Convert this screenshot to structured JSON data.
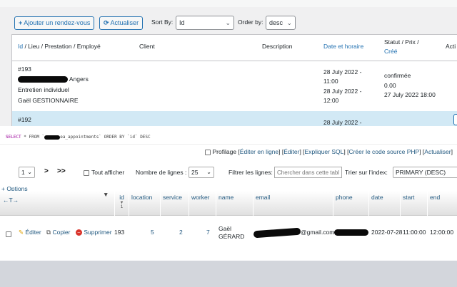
{
  "wp": {
    "toolbar": {
      "add_label": "Ajouter un rendez-vous",
      "refresh_label": "Actualiser",
      "sort_by_label": "Sort By:",
      "sort_by_value": "Id",
      "order_by_label": "Order by:",
      "order_by_value": "desc"
    },
    "columns": {
      "id_group": "Id / Lieu / Prestation / Employé",
      "client": "Client",
      "description": "Description",
      "datetime": "Date et horaire",
      "status_line1": "Statut / Prix /",
      "status_line2": "Créé",
      "actions": "Acti"
    },
    "row1": {
      "id": "#193",
      "location": "Angers",
      "service": "Entretien individuel",
      "employee": "Gaël GESTIONNAIRE",
      "date_start": "28 July 2022 -",
      "time_start": "11:00",
      "date_end": "28 July 2022 -",
      "time_end": "12:00",
      "status": "confirmée",
      "price": "0.00",
      "created": "27 July 2022 18:00"
    },
    "row2": {
      "id": "#192",
      "date_start": "28 July 2022 -"
    }
  },
  "pma": {
    "sql": {
      "select": "SELECT",
      "star_from": " * FROM `",
      "table_suffix": "ea_appointments",
      "order_by": "` ORDER BY `id` DESC"
    },
    "links": {
      "profiling": "Profilage",
      "edit_inline": "Éditer en ligne",
      "edit": "Éditer",
      "explain": "Expliquer SQL",
      "create_code": "Créer le code source PHP",
      "refresh": "Actualiser"
    },
    "nav": {
      "page": "1",
      "next": ">",
      "last": ">>",
      "show_all": "Tout afficher",
      "rows_label": "Nombre de lignes :",
      "rows_value": "25",
      "filter_label": "Filtrer les lignes:",
      "filter_placeholder": "Chercher dans cette tabl",
      "sort_label": "Trier sur l'index:",
      "sort_value": "PRIMARY (DESC)"
    },
    "options": "+ Options",
    "columns": {
      "arrows": "←T→",
      "id": "id",
      "id_sort": "1",
      "location": "location",
      "service": "service",
      "worker": "worker",
      "name": "name",
      "email": "email",
      "phone": "phone",
      "date": "date",
      "start": "start",
      "end": "end"
    },
    "row": {
      "edit": "Éditer",
      "copy": "Copier",
      "delete": "Supprimer",
      "id": "193",
      "location": "5",
      "service": "2",
      "worker": "7",
      "name_first": "Gaël",
      "name_last": "GÉRARD",
      "email_domain": "@gmail.com",
      "date": "2022-07-28",
      "start": "11:00:00",
      "end": "12:00:00"
    }
  }
}
